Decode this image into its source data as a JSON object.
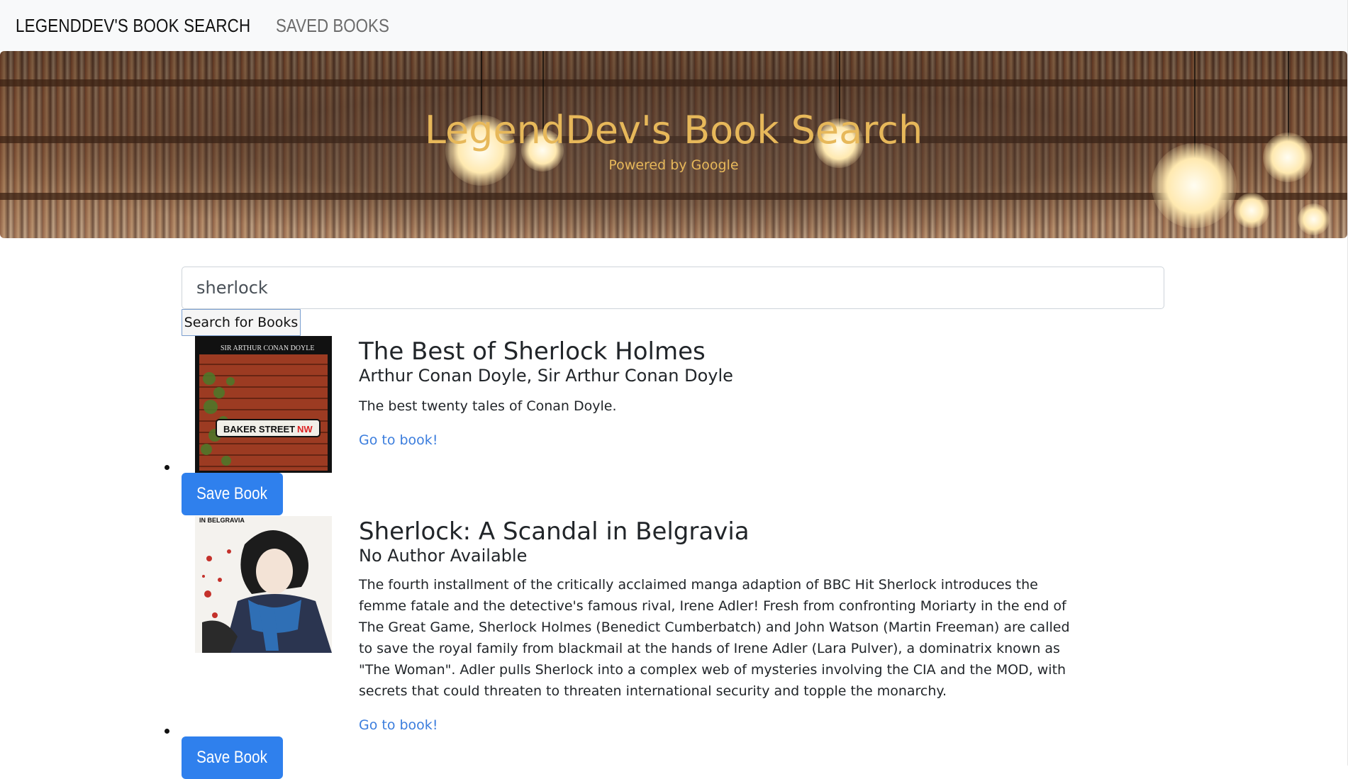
{
  "navbar": {
    "brand": "LEGENDDEV'S BOOK SEARCH",
    "saved_link": "SAVED BOOKS"
  },
  "hero": {
    "title": "LegendDev's Book Search",
    "subtitle": "Powered by Google"
  },
  "search": {
    "value": "sherlock",
    "button_label": "Search for Books"
  },
  "books": [
    {
      "title": "The Best of Sherlock Holmes",
      "authors": "Arthur Conan Doyle, Sir Arthur Conan Doyle",
      "description": "The best twenty tales of Conan Doyle.",
      "link_label": "Go to book!",
      "save_label": "Save Book",
      "cover": {
        "author_text": "SIR ARTHUR CONAN DOYLE",
        "sign_text": "BAKER STREET",
        "sign_suffix": "NW"
      }
    },
    {
      "title": "Sherlock: A Scandal in Belgravia",
      "authors": "No Author Available",
      "description": "The fourth installment of the critically acclaimed manga adaption of BBC Hit Sherlock introduces the femme fatale and the detective's famous rival, Irene Adler! Fresh from confronting Moriarty in the end of The Great Game, Sherlock Holmes (Benedict Cumberbatch) and John Watson (Martin Freeman) are called to save the royal family from blackmail at the hands of Irene Adler (Lara Pulver), a dominatrix known as \"The Woman\". Adler pulls Sherlock into a complex web of mysteries involving the CIA and the MOD, with secrets that could threaten to threaten international security and topple the monarchy.",
      "link_label": "Go to book!",
      "save_label": "Save Book",
      "cover": {
        "title_text": "IN BELGRAVIA"
      }
    }
  ],
  "colors": {
    "hero_text": "#e7b85a",
    "link": "#3b7ddd",
    "save_button": "#2f80ed",
    "navbar_bg": "#f8f9fa"
  }
}
